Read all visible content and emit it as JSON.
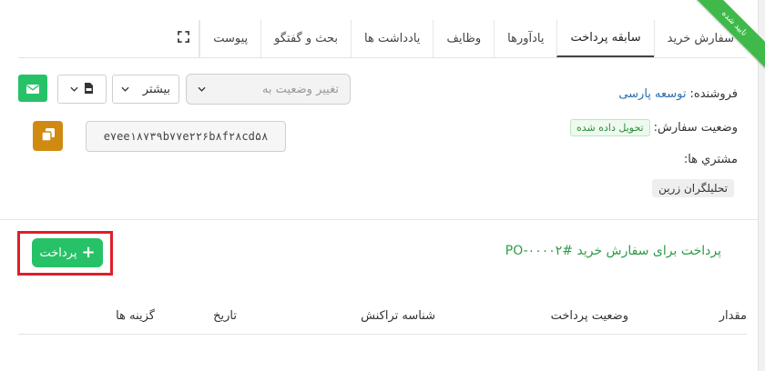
{
  "ribbon": {
    "label": "تایید شده",
    "color": "#3fb94a"
  },
  "tabs": [
    {
      "label": "سفارش خريد",
      "active": false
    },
    {
      "label": "سابقه پرداخت",
      "active": true
    },
    {
      "label": "يادآورها",
      "active": false
    },
    {
      "label": "وظايف",
      "active": false
    },
    {
      "label": "يادداشت ها",
      "active": false
    },
    {
      "label": "بحث و گفتگو",
      "active": false
    },
    {
      "label": "پیوست",
      "active": false
    }
  ],
  "info": {
    "vendor_label": "فروشنده:",
    "vendor_value": "توسعه پارسی",
    "status_label": "وضعيت سفارش:",
    "status_value": "تحویل داده شده",
    "customers_label": "مشتري ها:",
    "customer_value": "تحليلگران زرين"
  },
  "controls": {
    "status_select_placeholder": "تغییر وضعیت به",
    "more_label": "بیشتر",
    "hash_value": "e۷ee۱۸۷۳۹b۷۷e۲۲۶b۸f۲۸cd۵۸"
  },
  "payments": {
    "title": "پرداخت برای سفارش خرید #PO-۰۰۰۰۲",
    "button_label": "پرداخت",
    "columns": [
      "مقدار",
      "وضعیت پرداخت",
      "شناسه تراکنش",
      "تاریخ",
      "گزینه ها"
    ]
  },
  "colors": {
    "green": "#27c267",
    "orange": "#d08a12",
    "highlight": "#e11d2a",
    "link": "#2a6fb3"
  }
}
